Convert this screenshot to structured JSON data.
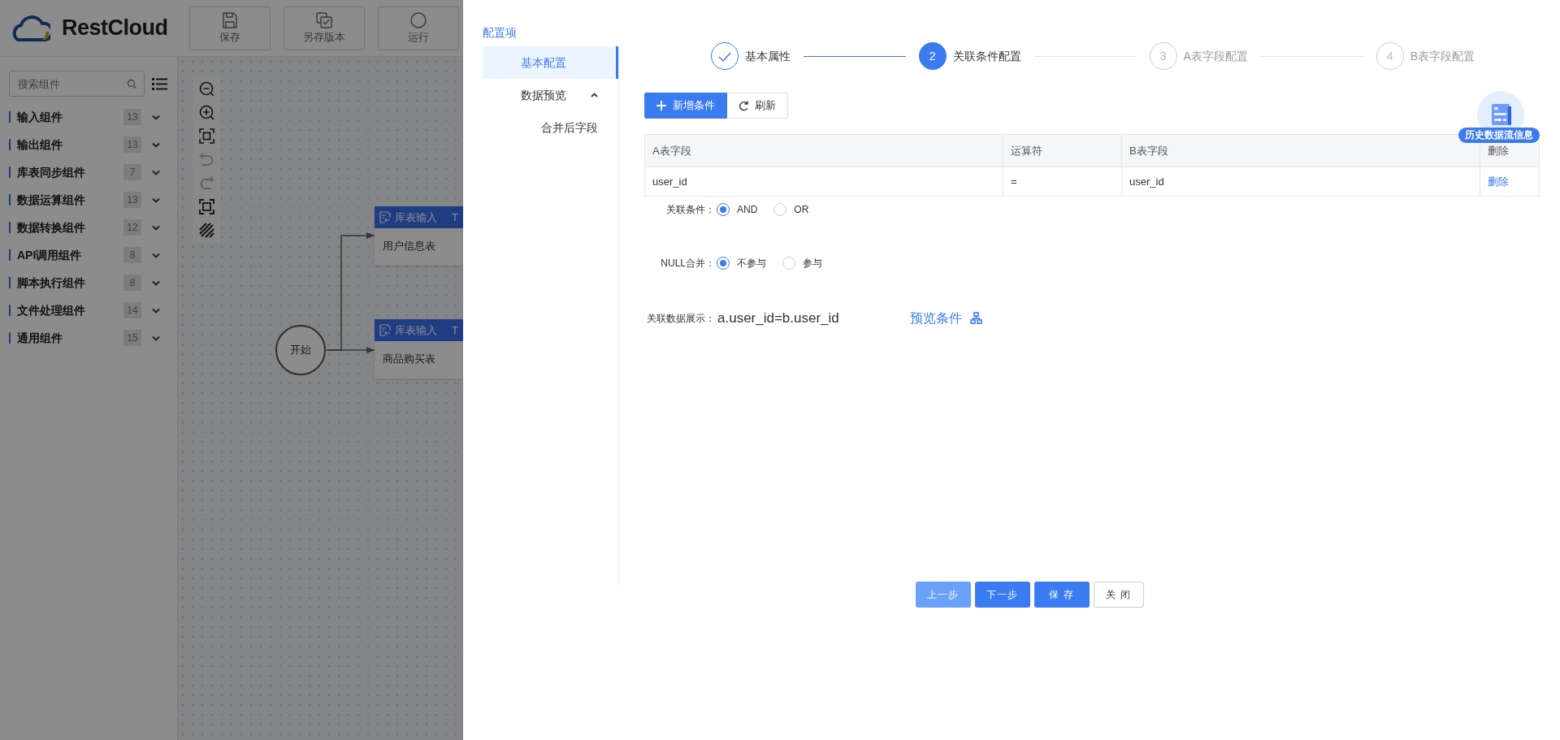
{
  "app": {
    "logo": "RestCloud",
    "toolbar": [
      {
        "kind": "save",
        "label": "保存"
      },
      {
        "kind": "version",
        "label": "另存版本"
      },
      {
        "kind": "run",
        "label": "运行"
      }
    ],
    "search": {
      "placeholder": "搜索组件"
    },
    "categories": [
      {
        "label": "输入组件",
        "count": "13"
      },
      {
        "label": "输出组件",
        "count": "13"
      },
      {
        "label": "库表同步组件",
        "count": "7"
      },
      {
        "label": "数据运算组件",
        "count": "13"
      },
      {
        "label": "数据转换组件",
        "count": "12"
      },
      {
        "label": "API调用组件",
        "count": "8"
      },
      {
        "label": "脚本执行组件",
        "count": "8"
      },
      {
        "label": "文件处理组件",
        "count": "14"
      },
      {
        "label": "通用组件",
        "count": "15"
      }
    ],
    "canvas_tools": [
      {
        "kind": "zoom-out",
        "disabled": false
      },
      {
        "kind": "zoom-in",
        "disabled": false
      },
      {
        "kind": "fit",
        "disabled": false
      },
      {
        "kind": "undo",
        "disabled": true
      },
      {
        "kind": "redo",
        "disabled": true
      },
      {
        "kind": "fullscreen",
        "disabled": false
      },
      {
        "kind": "hatch",
        "disabled": false
      }
    ],
    "nodes": [
      {
        "kind": "start",
        "label": "开始"
      },
      {
        "kind": "table",
        "type_label": "库表输入",
        "tag": "T",
        "title": "用户信息表"
      },
      {
        "kind": "table",
        "type_label": "库表输入",
        "tag": "T",
        "title": "商品购买表"
      }
    ]
  },
  "drawer": {
    "menu": {
      "title": "配置项",
      "items": [
        {
          "label": "基本配置",
          "selected": true
        },
        {
          "label": "数据预览",
          "selected": false,
          "expanded": true,
          "children": [
            {
              "label": "合并后字段",
              "selected": false
            }
          ]
        }
      ]
    },
    "steps": [
      {
        "finished": true,
        "selected": false,
        "label": "基本属性"
      },
      {
        "finished": false,
        "selected": true,
        "number": "2",
        "label": "关联条件配置"
      },
      {
        "finished": false,
        "selected": false,
        "number": "3",
        "label": "A表字段配置"
      },
      {
        "finished": false,
        "selected": false,
        "number": "4",
        "label": "B表字段配置"
      }
    ],
    "actions": [
      {
        "kind": "add",
        "label": "新增条件"
      },
      {
        "kind": "refresh",
        "label": "刷新"
      }
    ],
    "table": {
      "columns": [
        "A表字段",
        "运算符",
        "B表字段",
        "删除"
      ],
      "rows": [
        {
          "a_field": "user_id",
          "operator": "=",
          "b_field": "user_id",
          "action": "删除"
        }
      ]
    },
    "join_condition": {
      "label": "关联条件：",
      "options": [
        {
          "label": "AND",
          "selected": true
        },
        {
          "label": "OR",
          "selected": false
        }
      ]
    },
    "null_merge": {
      "label": "NULL合并：",
      "options": [
        {
          "label": "不参与",
          "selected": true
        },
        {
          "label": "参与",
          "selected": false
        }
      ]
    },
    "display": {
      "label": "关联数据展示：",
      "value": "a.user_id=b.user_id",
      "link": "预览条件"
    },
    "history": {
      "label": "历史数据流信息"
    },
    "footer": [
      {
        "kind": "light",
        "label": "上一步"
      },
      {
        "kind": "primary",
        "label": "下一步"
      },
      {
        "kind": "primary",
        "label": "保 存"
      },
      {
        "kind": "default",
        "label": "关 闭"
      }
    ]
  }
}
